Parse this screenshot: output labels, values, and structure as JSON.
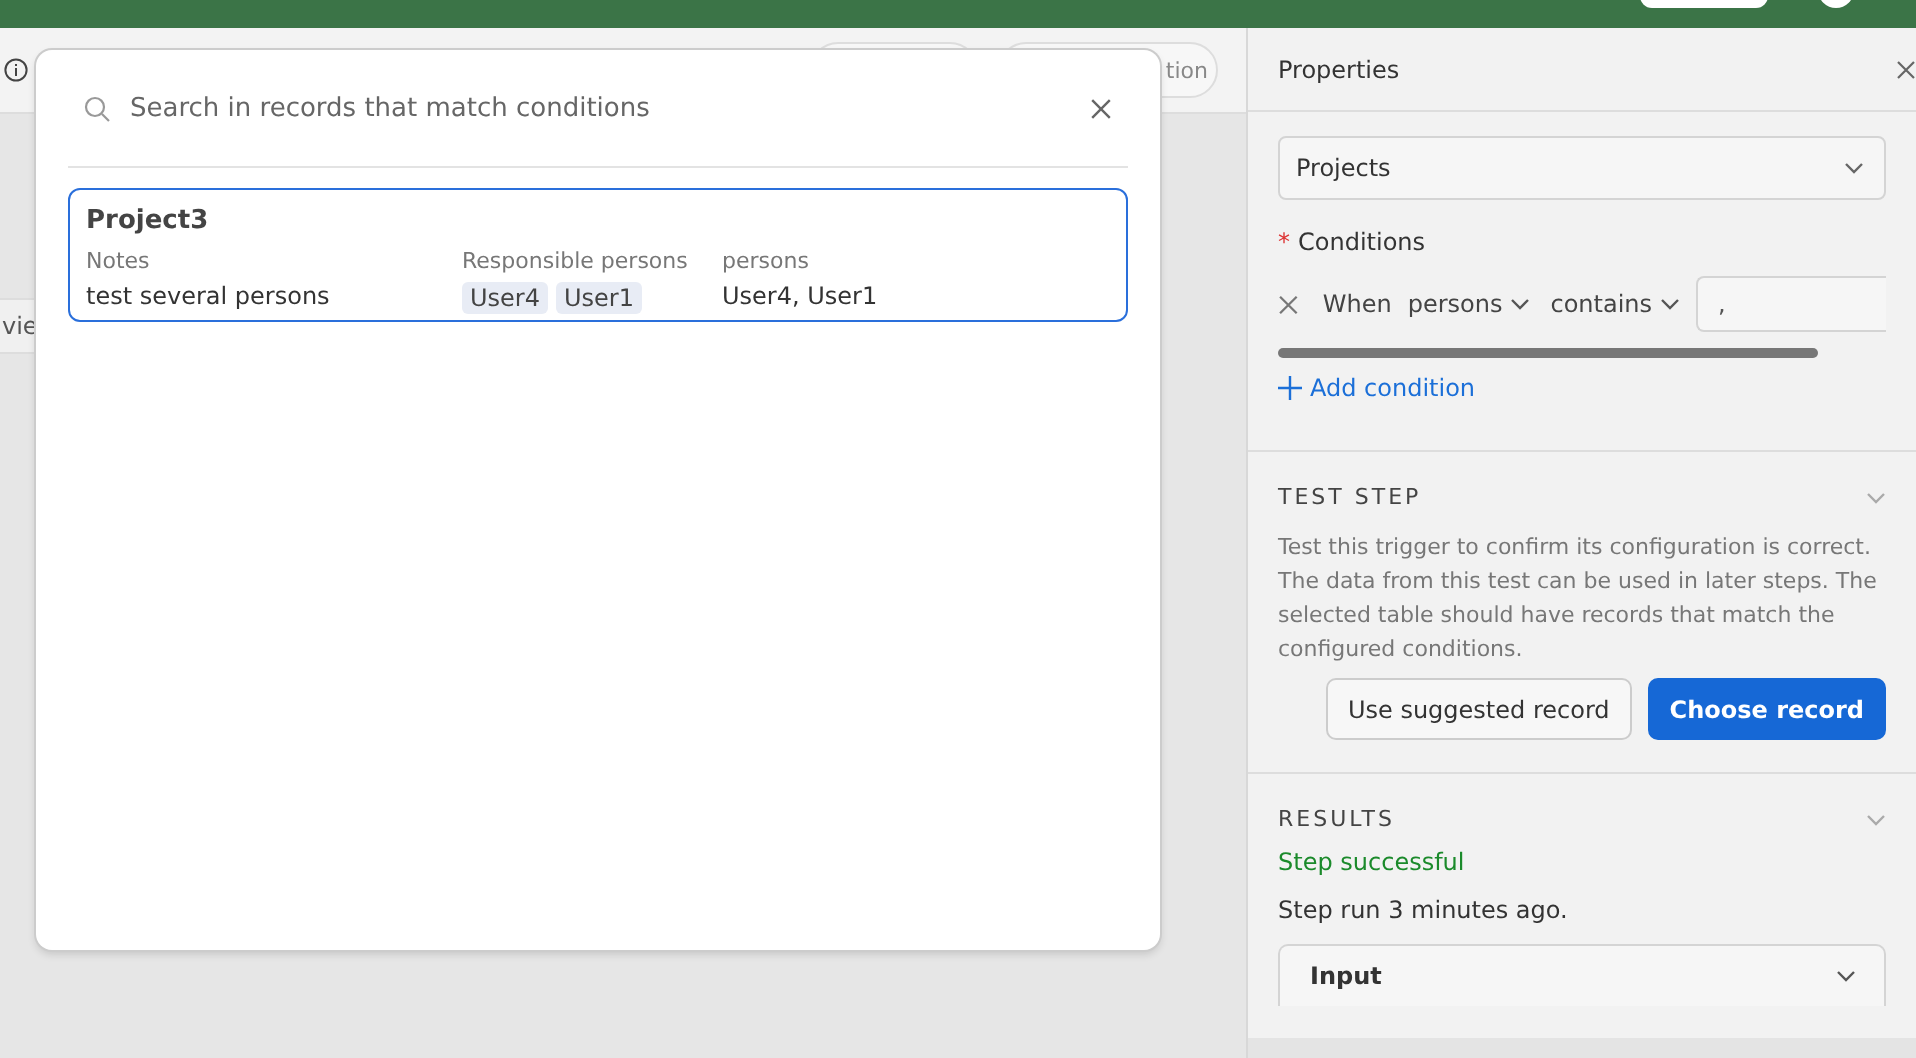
{
  "background": {
    "toolbar_button": "tion",
    "view_tab": "vie"
  },
  "record_picker": {
    "search": {
      "placeholder": "Search in records that match conditions"
    },
    "records": [
      {
        "title": "Project3",
        "selected": true,
        "fields": [
          {
            "label": "Notes",
            "kind": "text",
            "value": "test several persons"
          },
          {
            "label": "Responsible persons",
            "kind": "tags",
            "tags": [
              "User4",
              "User1"
            ]
          },
          {
            "label": "persons",
            "kind": "text",
            "value": "User4, User1"
          }
        ]
      }
    ]
  },
  "properties": {
    "title": "Properties",
    "table_select": "Projects",
    "conditions": {
      "label": "Conditions",
      "required_mark": "*",
      "rows": [
        {
          "prefix": "When",
          "field": "persons",
          "operator": "contains",
          "value": ","
        }
      ],
      "add_label": "Add condition"
    },
    "test_step": {
      "heading": "TEST STEP",
      "description": "Test this trigger to confirm its configuration is correct. The data from this test can be used in later steps. The selected table should have records that match the configured conditions.",
      "buttons": [
        {
          "label": "Use suggested record",
          "kind": "secondary"
        },
        {
          "label": "Choose record",
          "kind": "primary"
        }
      ]
    },
    "results": {
      "heading": "RESULTS",
      "status": "Step successful",
      "run_info": "Step run 3 minutes ago.",
      "panel": "Input"
    }
  }
}
